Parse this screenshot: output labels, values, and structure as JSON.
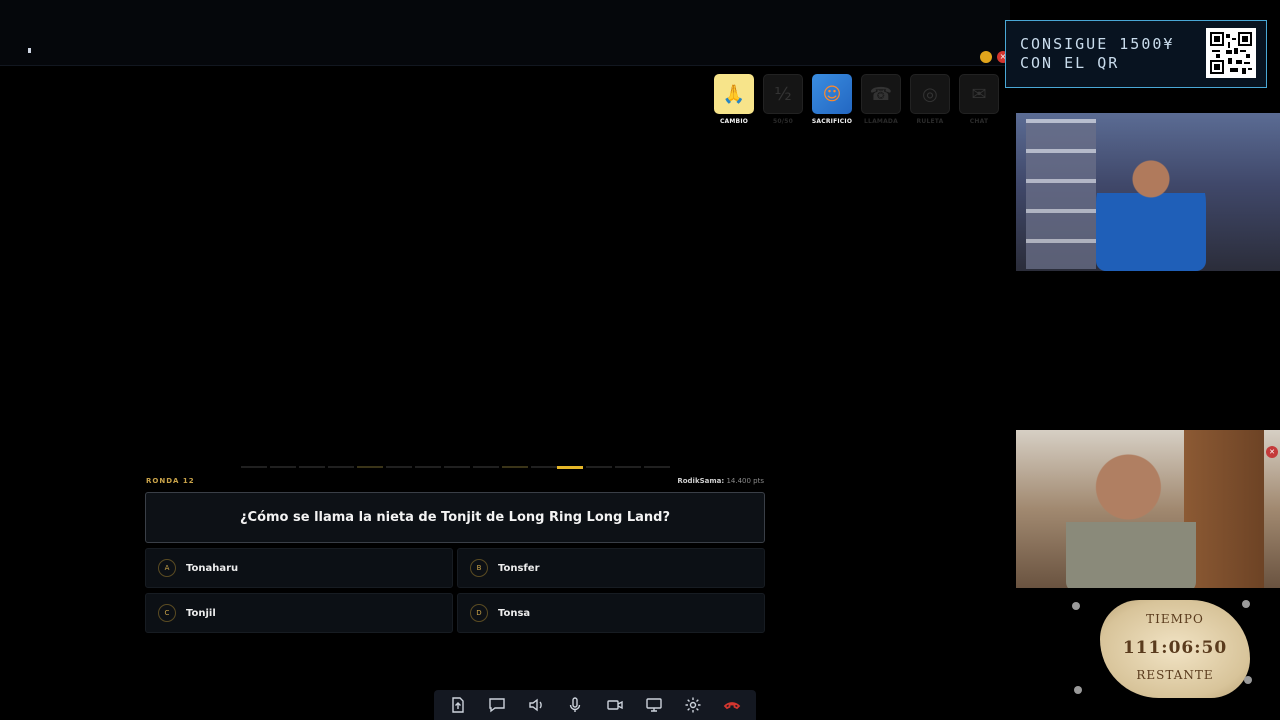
{
  "promo": {
    "line1": "CONSIGUE 1500¥",
    "line2": "CON EL QR"
  },
  "powerups": [
    {
      "label": "CAMBIO",
      "icon": "hands-icon",
      "state": "active"
    },
    {
      "label": "50/50",
      "icon": "fifty-fifty-icon",
      "state": "used"
    },
    {
      "label": "SACRIFICIO",
      "icon": "character-icon",
      "state": "active"
    },
    {
      "label": "LLAMADA",
      "icon": "phone-call-icon",
      "state": "used"
    },
    {
      "label": "RULETA",
      "icon": "roulette-icon",
      "state": "used"
    },
    {
      "label": "CHAT",
      "icon": "chat-icon",
      "state": "used"
    }
  ],
  "quiz": {
    "round": "RONDA 12",
    "player": "RodikSama:",
    "points": "14.400 pts",
    "question": "¿Cómo se llama la nieta de Tonjit de Long Ring Long Land?",
    "answers": [
      {
        "letter": "A",
        "text": "Tonaharu"
      },
      {
        "letter": "B",
        "text": "Tonsfer"
      },
      {
        "letter": "C",
        "text": "Tonjil"
      },
      {
        "letter": "D",
        "text": "Tonsa"
      }
    ]
  },
  "timer": {
    "top": "TIEMPO",
    "value": "111:06:50",
    "bottom": "RESTANTE"
  },
  "toolbar": [
    "share-screen-icon",
    "chat-icon",
    "speaker-icon",
    "microphone-icon",
    "camera-icon",
    "screen-icon",
    "gear-icon",
    "hang-up-icon"
  ],
  "colors": {
    "accent": "#e6b729",
    "promo_border": "#4aa8d6",
    "hang_up": "#d3362f"
  }
}
